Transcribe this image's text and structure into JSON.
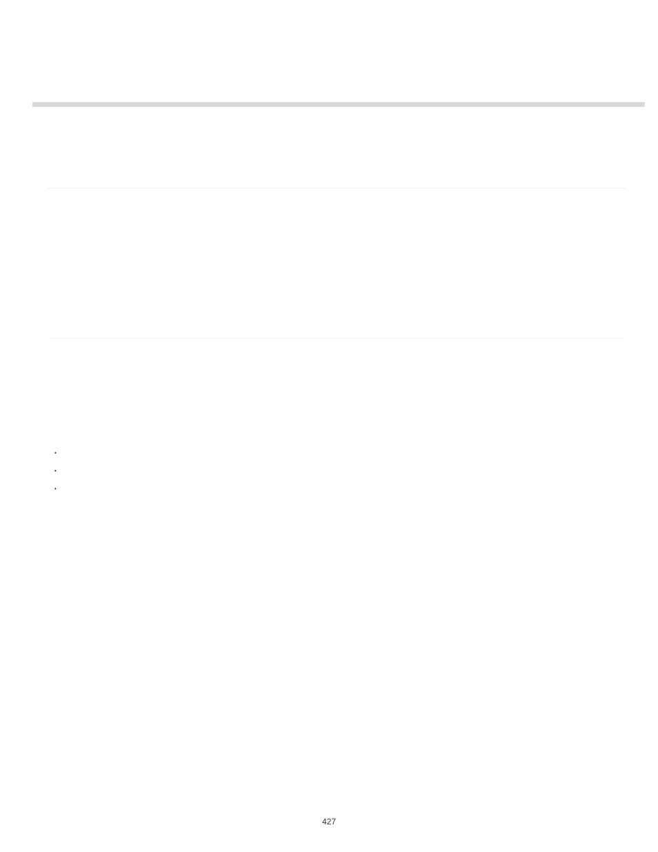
{
  "bullets": [
    "•",
    "•",
    "•"
  ],
  "pageNumber": "427"
}
